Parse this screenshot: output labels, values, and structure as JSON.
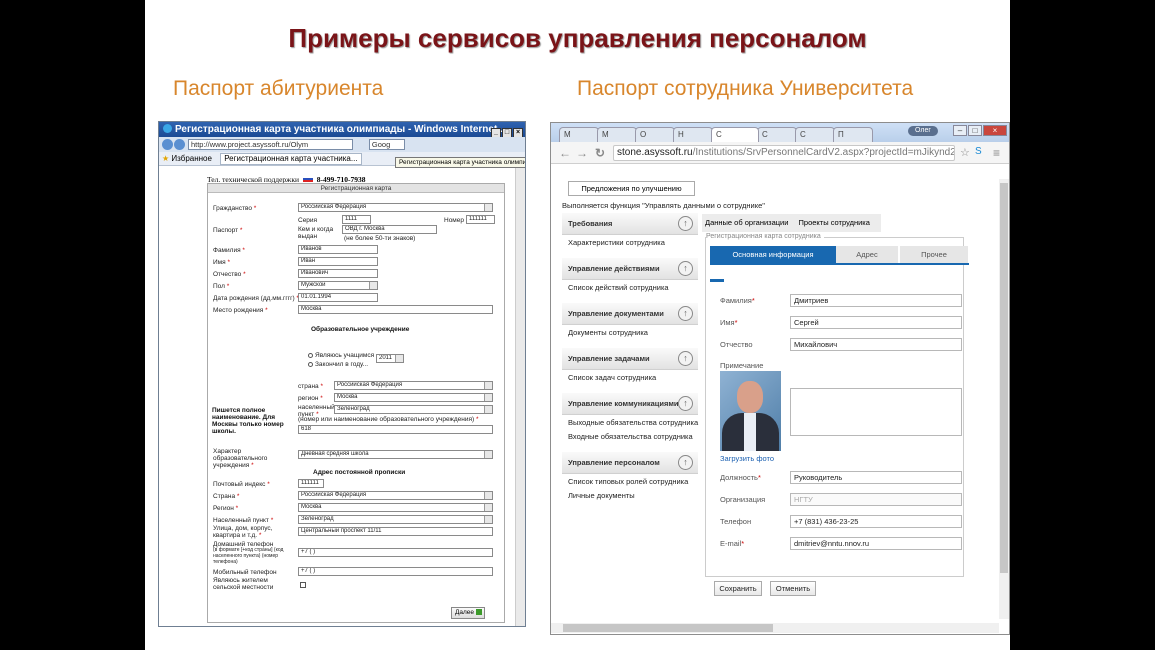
{
  "slide": {
    "title": "Примеры сервисов управления персоналом",
    "subtitle_left": "Паспорт абитуриента",
    "subtitle_right": "Паспорт сотрудника Университета"
  },
  "left_window": {
    "title": "Регистрационная карта участника олимпиады - Windows Internet ...",
    "url": "http://www.project.asyssoft.ru/Olym",
    "search_text": "Goog",
    "tooltip": "Регистрационная карта участника олимпиады",
    "favorites_label": "Избранное",
    "tab_label": "Регистрационная карта участника...",
    "support_label": "Тел. технической поддержки",
    "support_phone": "8-499-710-7938",
    "form": {
      "header": "Регистрационная карта",
      "citizenship_label": "Гражданство",
      "citizenship_value": "Российская Федерация",
      "passport_label": "Паспорт",
      "series_label": "Серия",
      "series_value": "1111",
      "number_label": "Номер",
      "number_value": "111111",
      "issued_label": "Кем и когда выдан",
      "issued_value": "ОВД г. Москва",
      "issued_hint": "(не более 50-ти знаков)",
      "last_name_label": "Фамилия",
      "last_name_value": "Иванов",
      "first_name_label": "Имя",
      "first_name_value": "Иван",
      "patronymic_label": "Отчество",
      "patronymic_value": "Иванович",
      "gender_label": "Пол",
      "gender_value": "Мужской",
      "birthdate_label": "Дата рождения (дд.мм.гггг)",
      "birthdate_value": "01.01.1994",
      "birthplace_label": "Место рождения",
      "birthplace_value": "Москва",
      "edu_section": "Образовательное учреждение",
      "radio_studying": "Являюсь учащимся",
      "radio_graduated": "Закончил в году...",
      "year_value": "2011",
      "country_label": "страна",
      "country_value": "Российская Федерация",
      "region_label": "регион",
      "region_value": "Москва",
      "locality_label": "населенный пункт",
      "locality_value": "Зеленоград",
      "school_hint": "Пишется полное наименование. Для Москвы только номер школы.",
      "school_label": "(номер или наименование образовательного учреждения)",
      "school_value": "618",
      "edu_type_label": "Характер образовательного учреждения",
      "edu_type_value": "Дневная средняя школа",
      "addr_section": "Адрес постоянной прописки",
      "postcode_label": "Почтовый индекс",
      "postcode_value": "111111",
      "addr_country_label": "Страна",
      "addr_country_value": "Российская Федерация",
      "addr_region_label": "Регион",
      "addr_region_value": "Москва",
      "addr_locality_label": "Населенный пункт",
      "addr_locality_value": "Зеленоград",
      "street_label": "Улица, дом, корпус, квартира и т.д.",
      "street_value": "Центральный проспект 11/11",
      "home_phone_label": "Домашний телефон",
      "home_phone_hint": "(в формате [+код страны] (код населенного пункта) (номер телефона)",
      "home_phone_value": "+7 (  )",
      "mobile_label": "Мобильный телефон",
      "mobile_value": "+7 (  )",
      "rural_label": "Являюсь жителем сельской местности",
      "next_button": "Далее"
    }
  },
  "right_window": {
    "tabs": [
      "М",
      "М",
      "О",
      "Н",
      "С",
      "С",
      "С",
      "П"
    ],
    "user_badge": "Олег",
    "url_host": "stone.asyssoft.ru",
    "url_path": "/Institutions/SrvPersonnelCardV2.aspx?projectId=mJikynd2",
    "suggest_button": "Предложения по улучшению",
    "function_line": "Выполняется функция \"Управлять данными о сотруднике\"",
    "sidebar": [
      {
        "head": "Требования",
        "items": [
          "Характеристики сотрудника"
        ]
      },
      {
        "head": "Управление действиями",
        "items": [
          "Список действий сотрудника"
        ]
      },
      {
        "head": "Управление документами",
        "items": [
          "Документы сотрудника"
        ]
      },
      {
        "head": "Управление задачами",
        "items": [
          "Список задач сотрудника"
        ]
      },
      {
        "head": "Управление коммуникациями",
        "items": [
          "Выходные обязательства сотрудника",
          "Входные обязательства сотрудника"
        ]
      },
      {
        "head": "Управление персоналом",
        "items": [
          "Список типовых ролей сотрудника",
          "Личные документы"
        ]
      }
    ],
    "top_tabs": [
      "Данные об организации",
      "Проекты сотрудника"
    ],
    "card_legend": "Регистрационная карта сотрудника",
    "inner_tabs": [
      "Основная информация",
      "Адрес",
      "Прочее"
    ],
    "fields": {
      "last_name_label": "Фамилия",
      "last_name_value": "Дмитриев",
      "first_name_label": "Имя",
      "first_name_value": "Сергей",
      "patronymic_label": "Отчество",
      "patronymic_value": "Михайлович",
      "note_label": "Примечание",
      "upload_link": "Загрузить фото",
      "position_label": "Должность",
      "position_value": "Руководитель",
      "org_label": "Организация",
      "org_value": "НГТУ",
      "phone_label": "Телефон",
      "phone_value": "+7 (831) 436-23-25",
      "email_label": "E-mail",
      "email_value": "dmitriev@nntu.nnov.ru"
    },
    "save_button": "Сохранить",
    "cancel_button": "Отменить"
  }
}
